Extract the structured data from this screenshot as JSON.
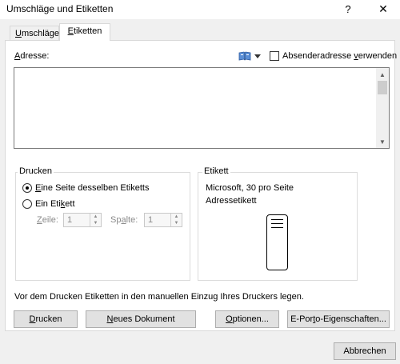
{
  "window": {
    "title": "Umschläge und Etiketten",
    "help_label": "?",
    "close_label": "✕"
  },
  "tabs": [
    {
      "label_pre": "",
      "label_key": "U",
      "label_post": "mschläge",
      "active": false
    },
    {
      "label_pre": "",
      "label_key": "E",
      "label_post": "tiketten",
      "active": true
    }
  ],
  "address": {
    "label_key": "A",
    "label_post": "dresse:",
    "value": "",
    "book_icon": "address-book-icon",
    "sender_checkbox_pre": "Absenderadresse ",
    "sender_checkbox_key": "v",
    "sender_checkbox_post": "erwenden",
    "sender_checked": false
  },
  "print_group": {
    "label": "Drucken",
    "option1_pre": "",
    "option1_key": "E",
    "option1_post": "ine Seite desselben Etiketts",
    "option1_selected": true,
    "option2_pre": "Ein Eti",
    "option2_key": "k",
    "option2_post": "ett",
    "option2_selected": false,
    "row_label_pre": "",
    "row_label_key": "Z",
    "row_label_post": "eile:",
    "row_value": "1",
    "col_label_pre": "Sp",
    "col_label_key": "a",
    "col_label_post": "lte:",
    "col_value": "1"
  },
  "label_group": {
    "label": "Etikett",
    "line1": "Microsoft, 30 pro Seite",
    "line2": "Adressetikett"
  },
  "note": "Vor dem Drucken Etiketten in den manuellen Einzug Ihres Druckers legen.",
  "buttons": {
    "print_key": "D",
    "print_post": "rucken",
    "new_doc_key": "N",
    "new_doc_post": "eues Dokument",
    "options_key": "O",
    "options_post": "ptionen...",
    "eporto_pre": "E-Por",
    "eporto_key": "t",
    "eporto_post": "o-Eigenschaften...",
    "cancel": "Abbrechen"
  }
}
